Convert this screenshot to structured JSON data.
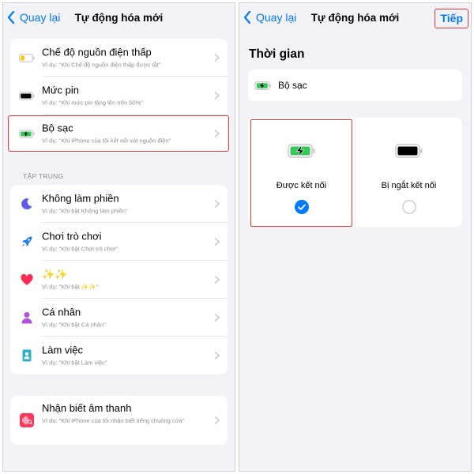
{
  "left": {
    "nav": {
      "back_label": "Quay lại",
      "title": "Tự động hóa mới"
    },
    "group1": [
      {
        "title": "Chế độ nguồn điện thấp",
        "subtitle": "Ví dụ: \"Khi Chế độ nguồn điện thấp được tắt\"",
        "icon": "low-power-battery-icon"
      },
      {
        "title": "Mức pin",
        "subtitle": "Ví dụ: \"Khi mức pin tăng lên trên 50%\"",
        "icon": "battery-level-icon"
      },
      {
        "title": "Bộ sạc",
        "subtitle": "Ví dụ: \"Khi iPhone của tôi kết nối với nguồn điện\"",
        "icon": "charging-battery-icon"
      }
    ],
    "section_header": "TẬP TRUNG",
    "group2": [
      {
        "title": "Không làm phiền",
        "subtitle": "Ví dụ: \"Khi bật Không làm phiền\"",
        "icon": "moon-icon"
      },
      {
        "title": "Chơi trò chơi",
        "subtitle": "Ví dụ: \"Khi bật Chơi trò chơi\"",
        "icon": "rocket-icon"
      },
      {
        "title": "✨✨",
        "subtitle": "Ví dụ: \"Khi bật ✨✨\"",
        "icon": "heart-icon"
      },
      {
        "title": "Cá nhân",
        "subtitle": "Ví dụ: \"Khi bật Cá nhân\"",
        "icon": "person-icon"
      },
      {
        "title": "Làm việc",
        "subtitle": "Ví dụ: \"Khi bật Làm việc\"",
        "icon": "badge-icon"
      }
    ],
    "group3": [
      {
        "title": "Nhận biết âm thanh",
        "subtitle": "Ví dụ: \"Khi iPhone của tôi nhận biết tiếng chuông cửa\"",
        "icon": "sound-recognition-icon"
      }
    ]
  },
  "right": {
    "nav": {
      "back_label": "Quay lại",
      "title": "Tự động hóa mới",
      "next_label": "Tiếp"
    },
    "section_title": "Thời gian",
    "trigger_label": "Bộ sạc",
    "options": [
      {
        "label": "Được kết nối",
        "selected": true
      },
      {
        "label": "Bị ngắt kết nối",
        "selected": false
      }
    ]
  },
  "colors": {
    "accent": "#007aff",
    "highlight": "#e53935",
    "battery_green": "#34c759",
    "battery_yellow": "#ffcc00"
  }
}
